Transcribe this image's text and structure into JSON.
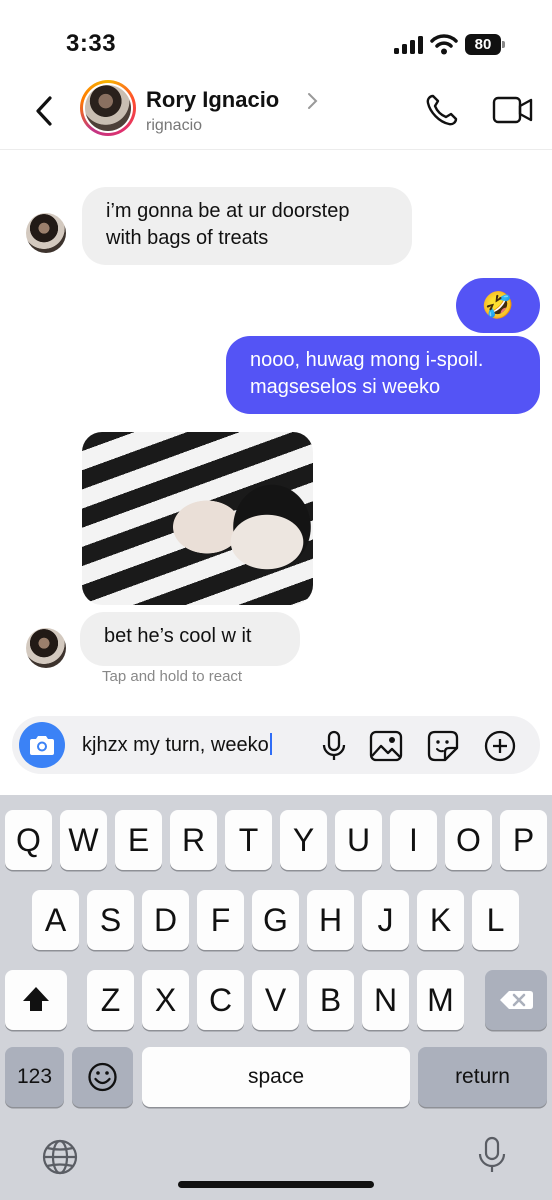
{
  "status_bar": {
    "time": "3:33",
    "battery": "80"
  },
  "header": {
    "name": "Rory Ignacio",
    "handle": "rignacio"
  },
  "messages": [
    {
      "sender": "them",
      "text_lines": [
        "i’m gonna be at ur doorstep",
        "with bags of treats"
      ]
    },
    {
      "sender": "me",
      "emoji": "🤣"
    },
    {
      "sender": "me",
      "text_lines": [
        "nooo, huwag mong i-spoil.",
        "magseselos si weeko"
      ]
    },
    {
      "sender": "them",
      "type": "photo",
      "description": "cat-on-lap"
    },
    {
      "sender": "them",
      "text": "bet he’s cool w it"
    }
  ],
  "hint": "Tap and hold to react",
  "composer": {
    "input_value": "kjhzx my turn, weeko"
  },
  "keyboard": {
    "row1": [
      "Q",
      "W",
      "E",
      "R",
      "T",
      "Y",
      "U",
      "I",
      "O",
      "P"
    ],
    "row2": [
      "A",
      "S",
      "D",
      "F",
      "G",
      "H",
      "J",
      "K",
      "L"
    ],
    "row3": [
      "Z",
      "X",
      "C",
      "V",
      "B",
      "N",
      "M"
    ],
    "numbers_label": "123",
    "space_label": "space",
    "return_label": "return"
  },
  "colors": {
    "accent": "#5454f5",
    "camera": "#3b82f6",
    "keyboard_bg": "#d1d3d9"
  },
  "icons": [
    "back-chevron-icon",
    "chevron-right-icon",
    "phone-icon",
    "video-camera-icon",
    "camera-icon",
    "microphone-icon",
    "image-icon",
    "sticker-icon",
    "plus-circle-icon",
    "shift-icon",
    "delete-icon",
    "emoji-icon",
    "globe-icon",
    "dictation-icon"
  ]
}
